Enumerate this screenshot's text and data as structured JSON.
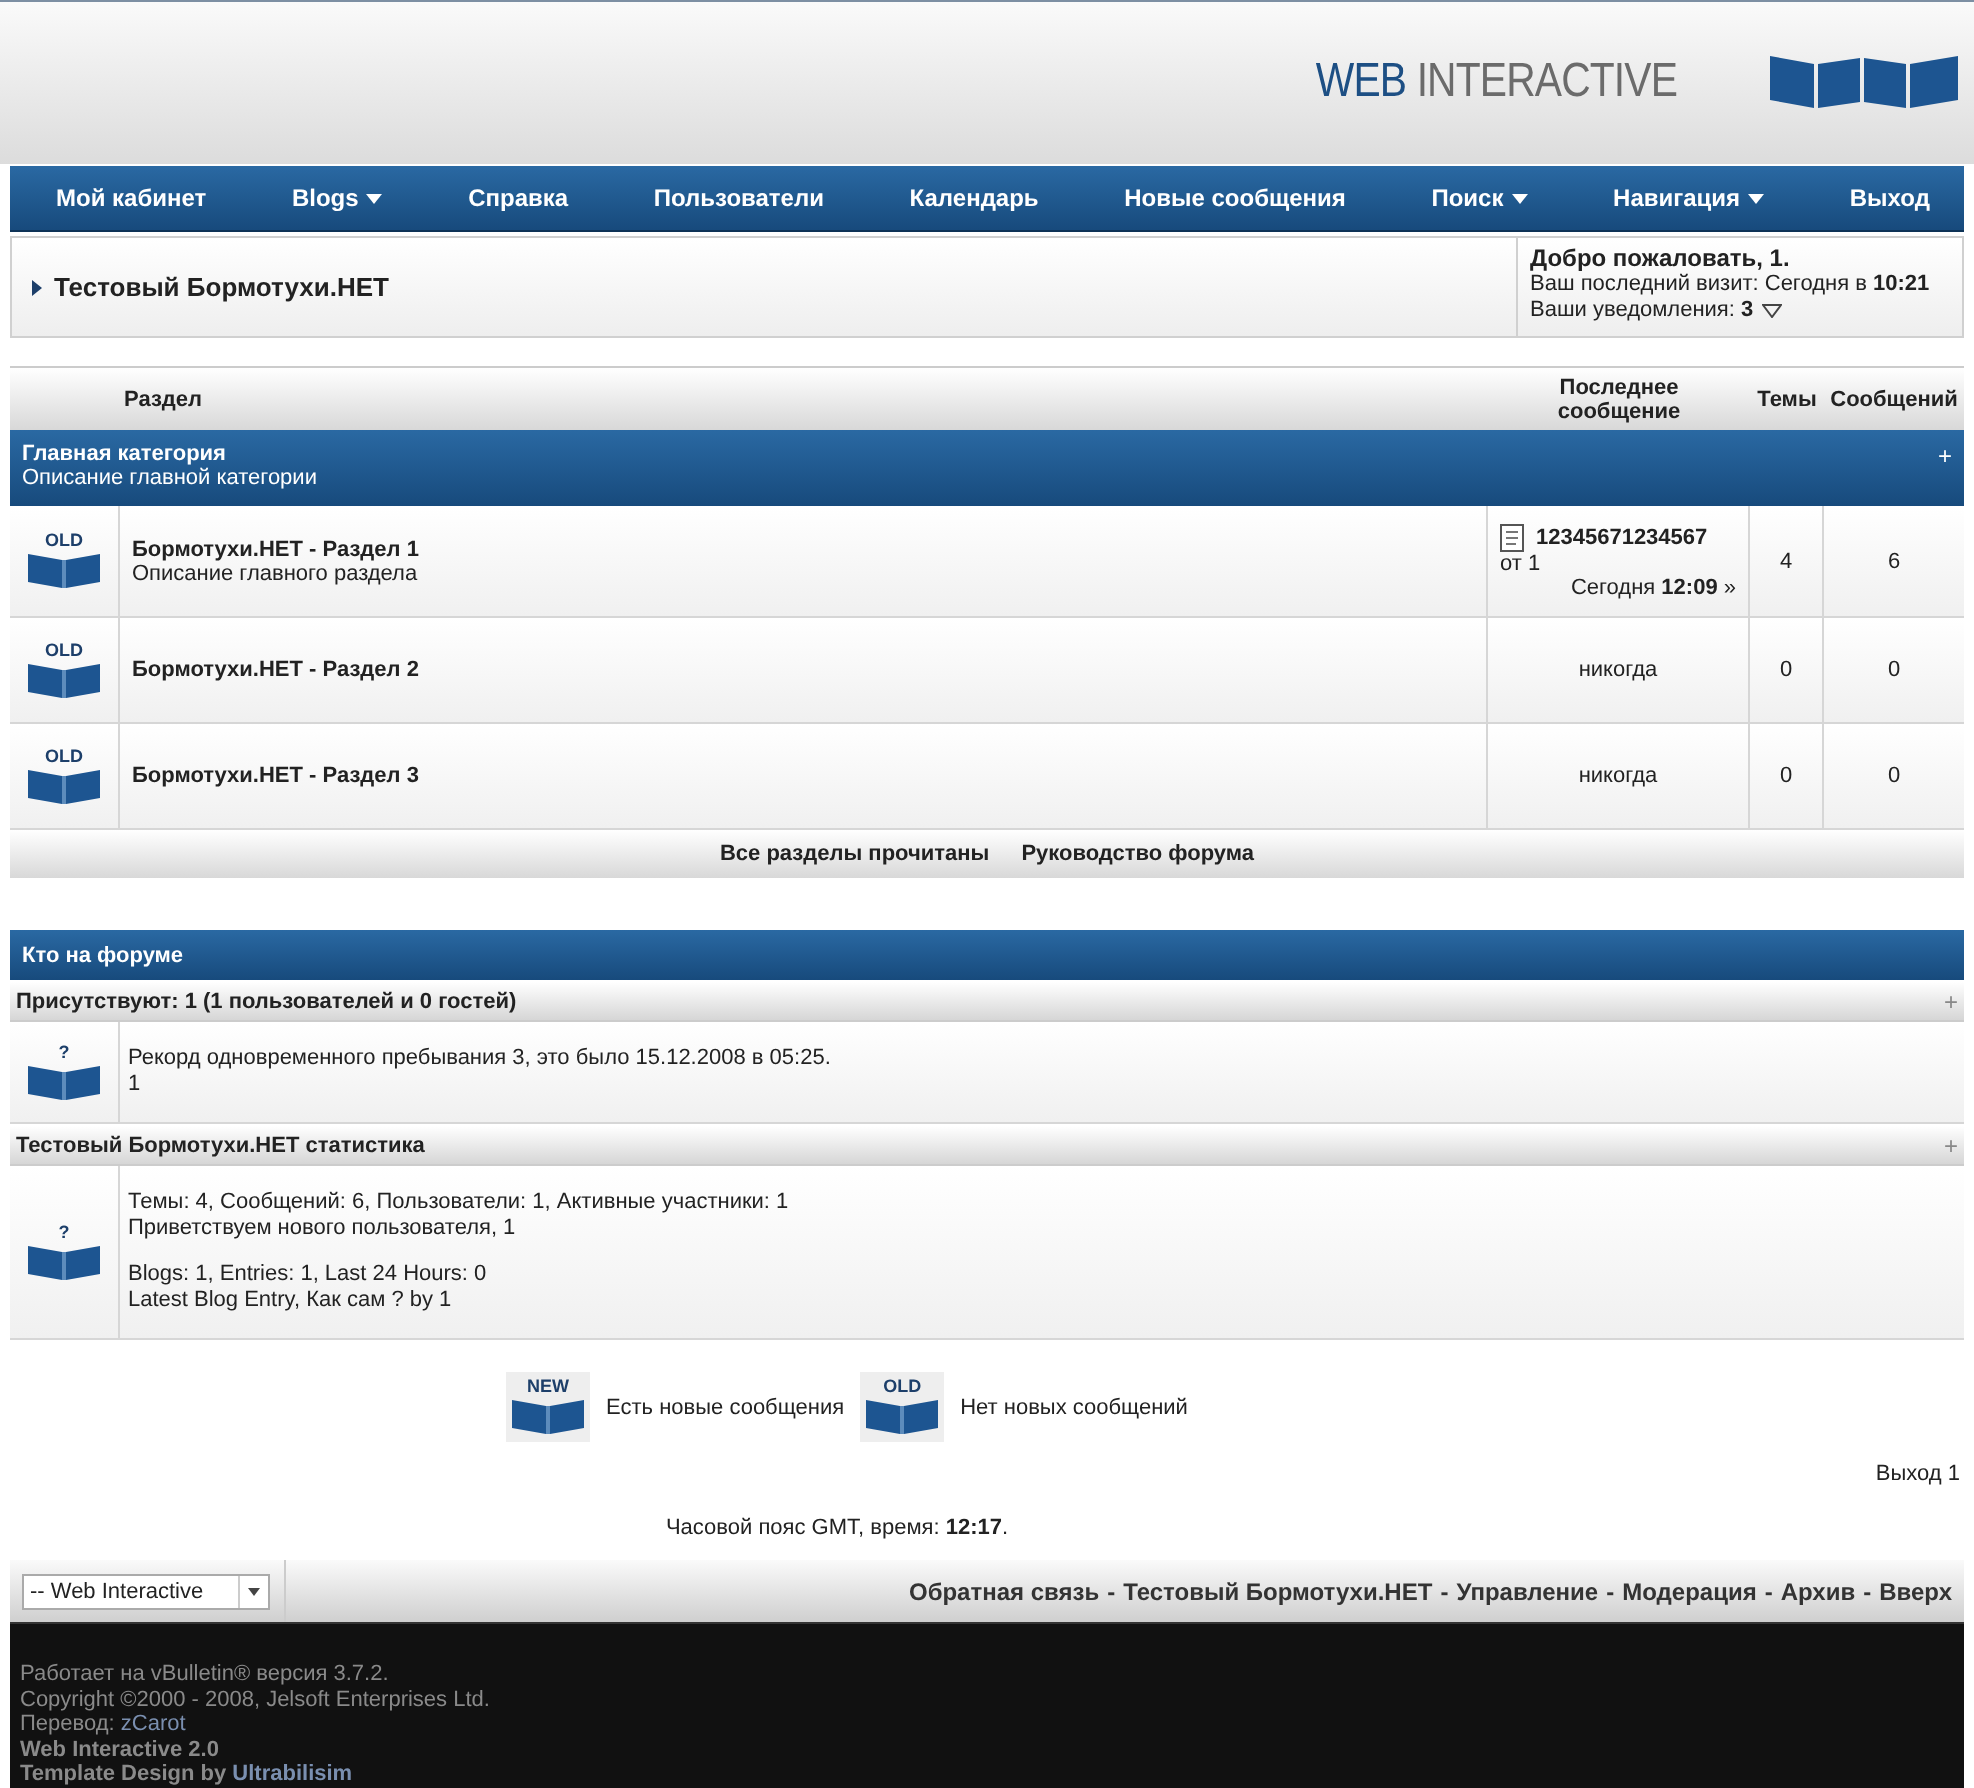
{
  "header": {
    "logo_strong": "WEB",
    "logo_light": "INTERACTIVE"
  },
  "nav": [
    {
      "label": "Мой кабинет",
      "dropdown": false
    },
    {
      "label": "Blogs",
      "dropdown": true
    },
    {
      "label": "Справка",
      "dropdown": false
    },
    {
      "label": "Пользователи",
      "dropdown": false
    },
    {
      "label": "Календарь",
      "dropdown": false
    },
    {
      "label": "Новые сообщения",
      "dropdown": false
    },
    {
      "label": "Поиск",
      "dropdown": true
    },
    {
      "label": "Навигация",
      "dropdown": true
    },
    {
      "label": "Выход",
      "dropdown": false
    }
  ],
  "breadcrumb": {
    "title": "Тестовый Бормотухи.НЕТ",
    "welcome": "Добро пожаловать, 1.",
    "last_visit": "Ваш последний визит: Сегодня в **10:21**",
    "notifications": "Ваши уведомления: **3**"
  },
  "forum_table": {
    "columns": [
      "Раздел",
      "Последнее сообщение",
      "Темы",
      "Сообщений"
    ],
    "category": {
      "title": "Главная категория",
      "description": "Описание главной категории",
      "toggle": "+"
    },
    "forums": [
      {
        "icon_label": "OLD",
        "title": "Бормотухи.НЕТ - Раздел 1",
        "description": "Описание главного раздела",
        "last_post": {
          "kind": "post",
          "thread": "12345671234567",
          "by": "от 1",
          "date": "Сегодня **12:09**",
          "go_to": "»"
        },
        "threads": "4",
        "posts": "6"
      },
      {
        "icon_label": "OLD",
        "title": "Бормотухи.НЕТ - Раздел 2",
        "last_post": {
          "kind": "never",
          "text": "никогда"
        },
        "threads": "0",
        "posts": "0"
      },
      {
        "icon_label": "OLD",
        "title": "Бормотухи.НЕТ - Раздел 3",
        "last_post": {
          "kind": "never",
          "text": "никогда"
        },
        "threads": "0",
        "posts": "0"
      }
    ],
    "footer_links": [
      "Все разделы прочитаны",
      "Руководство форума"
    ]
  },
  "whos_online": {
    "title": "Кто на форуме",
    "sections": [
      {
        "title": "Присутствуют: 1 (1 пользователей и 0 гостей)",
        "toggle": "+",
        "icon_label": "?",
        "paragraphs": [
          [
            "Рекорд одновременного пребывания 3, это было 15.12.2008 в 05:25.",
            "1"
          ]
        ]
      },
      {
        "title": "Тестовый Бормотухи.НЕТ статистика",
        "toggle": "+",
        "icon_label": "?",
        "paragraphs": [
          [
            "Темы: 4, Сообщений: 6, Пользователи: 1, Активные участники: 1",
            "Приветствуем нового пользователя, 1"
          ],
          [
            "Blogs: 1, Entries: 1, Last 24 Hours: 0",
            "Latest Blog Entry, Как сам ? by 1"
          ]
        ]
      }
    ]
  },
  "legend": [
    {
      "icon_label": "NEW",
      "text": "Есть новые сообщения"
    },
    {
      "icon_label": "OLD",
      "text": "Нет новых сообщений"
    }
  ],
  "logout": "Выход 1",
  "timezone": "Часовой пояс GMT, время: **12:17**.",
  "footer": {
    "style_select": "-- Web Interactive",
    "separator": "-",
    "links": [
      "Обратная связь",
      "Тестовый Бормотухи.НЕТ",
      "Управление",
      "Модерация",
      "Архив",
      "Вверх"
    ],
    "credits": [
      {
        "kind": "plain",
        "text": "Работает на vBulletin® версия 3.7.2."
      },
      {
        "kind": "plain",
        "text": "Copyright ©2000 - 2008, Jelsoft Enterprises Ltd."
      },
      {
        "kind": "link",
        "text": "Перевод:",
        "link": "zCarot"
      },
      {
        "kind": "bold",
        "text": "Web Interactive 2.0"
      },
      {
        "kind": "boldlink",
        "text": "Template Design by",
        "link": "Ultrabilisim"
      }
    ]
  }
}
